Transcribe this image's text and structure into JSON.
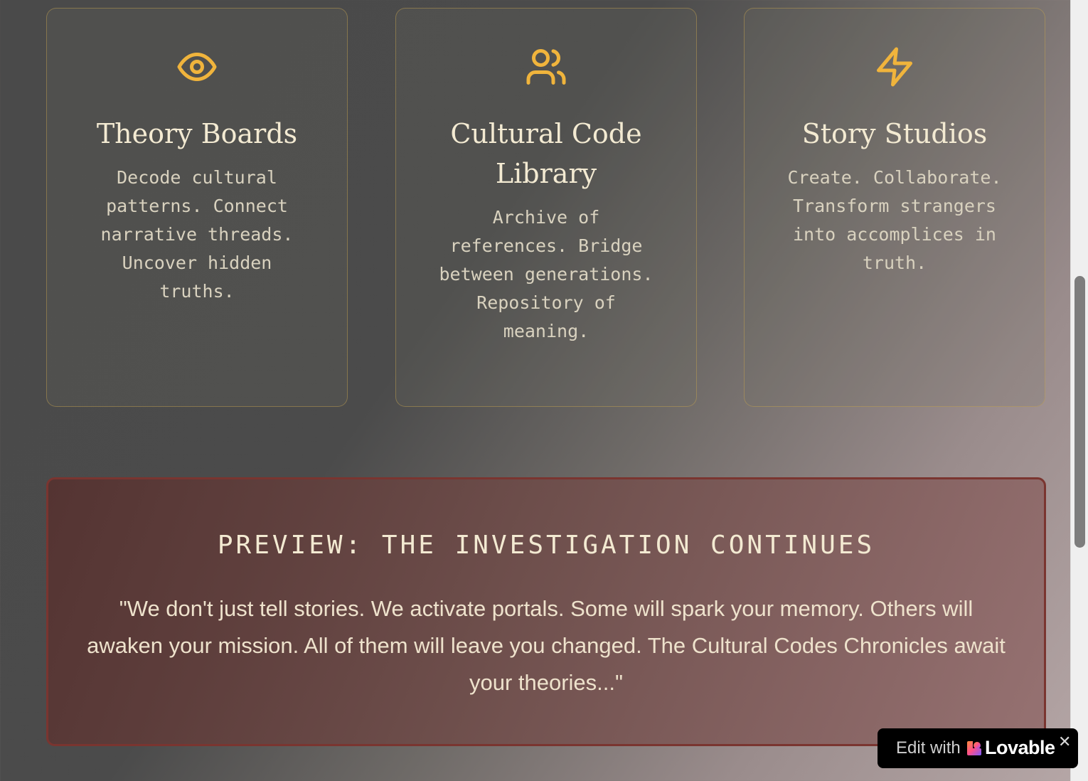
{
  "features": [
    {
      "icon": "eye-icon",
      "title": "Theory Boards",
      "description": "Decode cultural patterns. Connect narrative threads. Uncover hidden truths."
    },
    {
      "icon": "users-icon",
      "title": "Cultural Code Library",
      "description": "Archive of references. Bridge between generations. Repository of meaning."
    },
    {
      "icon": "lightning-icon",
      "title": "Story Studios",
      "description": "Create. Collaborate. Transform strangers into accomplices in truth."
    }
  ],
  "preview": {
    "heading": "PREVIEW: THE INVESTIGATION CONTINUES",
    "quote": "\"We don't just tell stories. We activate portals. Some will spark your memory. Others will awaken your mission. All of them will leave you changed. The Cultural Codes Chronicles await your theories...\""
  },
  "badge": {
    "edit_label": "Edit with",
    "brand": "Lovable",
    "close": "✕"
  },
  "colors": {
    "accent": "#f0b43c",
    "card_text": "#f3ead2",
    "preview_border": "#7a3530"
  }
}
